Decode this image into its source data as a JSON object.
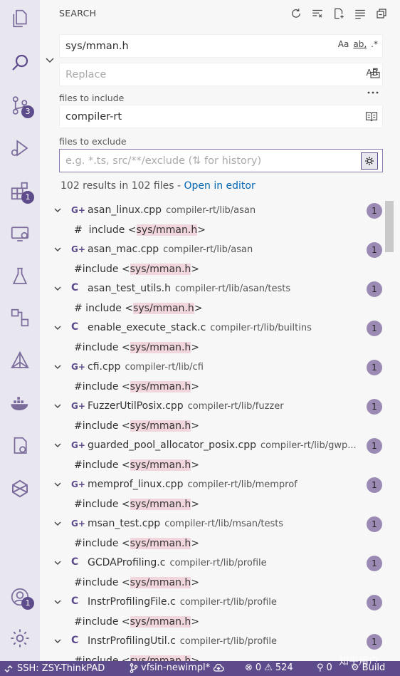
{
  "panel": {
    "title": "SEARCH"
  },
  "search": {
    "value": "sys/mman.h",
    "opt_case": "Aa",
    "opt_word": "ab",
    "opt_regex": ".*"
  },
  "replace": {
    "placeholder": "Replace",
    "opt_preserve": "AB"
  },
  "include": {
    "label": "files to include",
    "value": "compiler-rt"
  },
  "exclude": {
    "label": "files to exclude",
    "placeholder": "e.g. *.ts, src/**/exclude (⇅ for history)"
  },
  "summary": {
    "text": "102 results in 102 files - ",
    "link": "Open in editor"
  },
  "activity_badges": {
    "scm": "3",
    "extensions": "1",
    "accounts": "1"
  },
  "results": [
    {
      "icon": "G+",
      "name": "asan_linux.cpp",
      "path": "compiler-rt/lib/asan",
      "count": "1",
      "pre": "#  include <",
      "match": "sys/mman.h",
      "post": ">"
    },
    {
      "icon": "G+",
      "name": "asan_mac.cpp",
      "path": "compiler-rt/lib/asan",
      "count": "1",
      "pre": "#include <",
      "match": "sys/mman.h",
      "post": ">"
    },
    {
      "icon": "C",
      "name": "asan_test_utils.h",
      "path": "compiler-rt/lib/asan/tests",
      "count": "1",
      "pre": "# include <",
      "match": "sys/mman.h",
      "post": ">"
    },
    {
      "icon": "C",
      "name": "enable_execute_stack.c",
      "path": "compiler-rt/lib/builtins",
      "count": "1",
      "pre": "#include <",
      "match": "sys/mman.h",
      "post": ">"
    },
    {
      "icon": "G+",
      "name": "cfi.cpp",
      "path": "compiler-rt/lib/cfi",
      "count": "1",
      "pre": "#include <",
      "match": "sys/mman.h",
      "post": ">"
    },
    {
      "icon": "G+",
      "name": "FuzzerUtilPosix.cpp",
      "path": "compiler-rt/lib/fuzzer",
      "count": "1",
      "pre": "#include <",
      "match": "sys/mman.h",
      "post": ">"
    },
    {
      "icon": "G+",
      "name": "guarded_pool_allocator_posix.cpp",
      "path": "compiler-rt/lib/gwp...",
      "count": "1",
      "pre": "#include <",
      "match": "sys/mman.h",
      "post": ">"
    },
    {
      "icon": "G+",
      "name": "memprof_linux.cpp",
      "path": "compiler-rt/lib/memprof",
      "count": "1",
      "pre": "#include <",
      "match": "sys/mman.h",
      "post": ">"
    },
    {
      "icon": "G+",
      "name": "msan_test.cpp",
      "path": "compiler-rt/lib/msan/tests",
      "count": "1",
      "pre": "#include <",
      "match": "sys/mman.h",
      "post": ">"
    },
    {
      "icon": "C",
      "name": "GCDAProfiling.c",
      "path": "compiler-rt/lib/profile",
      "count": "1",
      "pre": "#include <",
      "match": "sys/mman.h",
      "post": ">"
    },
    {
      "icon": "C",
      "name": "InstrProfilingFile.c",
      "path": "compiler-rt/lib/profile",
      "count": "1",
      "pre": "#include <",
      "match": "sys/mman.h",
      "post": ">"
    },
    {
      "icon": "C",
      "name": "InstrProfilingUtil.c",
      "path": "compiler-rt/lib/profile",
      "count": "1",
      "pre": "#include <",
      "match": "sys/mman.h",
      "post": ">"
    }
  ],
  "status": {
    "remote": "SSH: ZSY-ThinkPAD",
    "branch": "vfsin-newimpl*",
    "errors": "0",
    "warnings": "524",
    "ports": "0",
    "build": "Build"
  },
  "watermark": "知乎用户",
  "colors": {
    "accent": "#5e4b8b",
    "highlight": "#f2d6de",
    "link": "#0065b3"
  }
}
